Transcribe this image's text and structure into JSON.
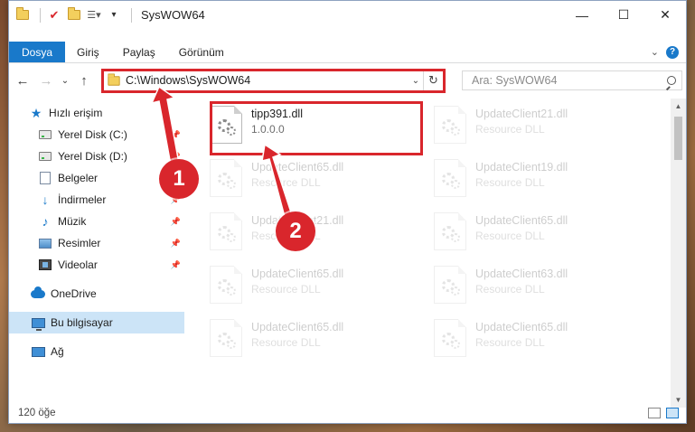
{
  "window": {
    "title": "SysWOW64",
    "controls": {
      "minimize": "—",
      "maximize": "☐",
      "close": "✕"
    }
  },
  "ribbon": {
    "tabs": [
      "Dosya",
      "Giriş",
      "Paylaş",
      "Görünüm"
    ],
    "expand_icon": "chevron-down-icon",
    "help_icon": "help-icon"
  },
  "address": {
    "path": "C:\\Windows\\SysWOW64",
    "search_placeholder": "Ara: SysWOW64"
  },
  "nav": {
    "quick_access": "Hızlı erişim",
    "items": [
      {
        "label": "Yerel Disk (C:)",
        "pinned": true
      },
      {
        "label": "Yerel Disk (D:)",
        "pinned": true
      },
      {
        "label": "Belgeler",
        "pinned": true
      },
      {
        "label": "İndirmeler",
        "pinned": true
      },
      {
        "label": "Müzik",
        "pinned": true
      },
      {
        "label": "Resimler",
        "pinned": true
      },
      {
        "label": "Videolar",
        "pinned": true
      }
    ],
    "onedrive": "OneDrive",
    "this_pc": "Bu bilgisayar",
    "network": "Ağ"
  },
  "files": [
    {
      "name": "tipp391.dll",
      "desc": "1.0.0.0",
      "highlighted": true
    },
    {
      "name": "UpdateClient21.dll",
      "desc": "Resource DLL"
    },
    {
      "name": "UpdateClient65.dll",
      "desc": "Resource DLL"
    },
    {
      "name": "UpdateClient19.dll",
      "desc": "Resource DLL"
    },
    {
      "name": "UpdateClient21.dll",
      "desc": "Resource DLL"
    },
    {
      "name": "UpdateClient65.dll",
      "desc": "Resource DLL"
    },
    {
      "name": "UpdateClient65.dll",
      "desc": "Resource DLL"
    },
    {
      "name": "UpdateClient63.dll",
      "desc": "Resource DLL"
    },
    {
      "name": "UpdateClient65.dll",
      "desc": "Resource DLL"
    },
    {
      "name": "UpdateClient65.dll",
      "desc": "Resource DLL"
    }
  ],
  "status": {
    "count": "120 öğe"
  },
  "annotations": {
    "step1": "1",
    "step2": "2",
    "color": "#d9262c"
  }
}
